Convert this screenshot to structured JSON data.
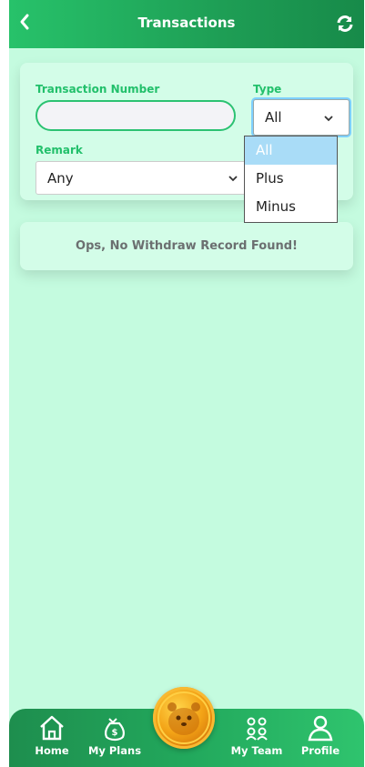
{
  "header": {
    "title": "Transactions",
    "back_icon": "chevron-left-icon",
    "refresh_icon": "refresh-icon"
  },
  "filters": {
    "transaction_number_label": "Transaction Number",
    "transaction_number_value": "",
    "type_label": "Type",
    "type_value": "All",
    "remark_label": "Remark",
    "remark_value": "Any"
  },
  "type_dropdown": {
    "options": [
      "All",
      "Plus",
      "Minus"
    ],
    "selected": "All"
  },
  "empty_message": "Ops, No Withdraw Record Found!",
  "bottom_nav": {
    "items": [
      {
        "label": "Home",
        "icon": "home-icon"
      },
      {
        "label": "My Plans",
        "icon": "money-bag-icon"
      },
      {
        "label": "My Team",
        "icon": "team-icon"
      },
      {
        "label": "Profile",
        "icon": "user-icon"
      }
    ],
    "center_icon": "hamster-coin-icon"
  },
  "colors": {
    "header_green": "#1e9e55",
    "background": "#c4fbdf",
    "card": "#d3fde8",
    "label_green": "#22c06b",
    "dropdown_selected": "#a9dcf7"
  }
}
